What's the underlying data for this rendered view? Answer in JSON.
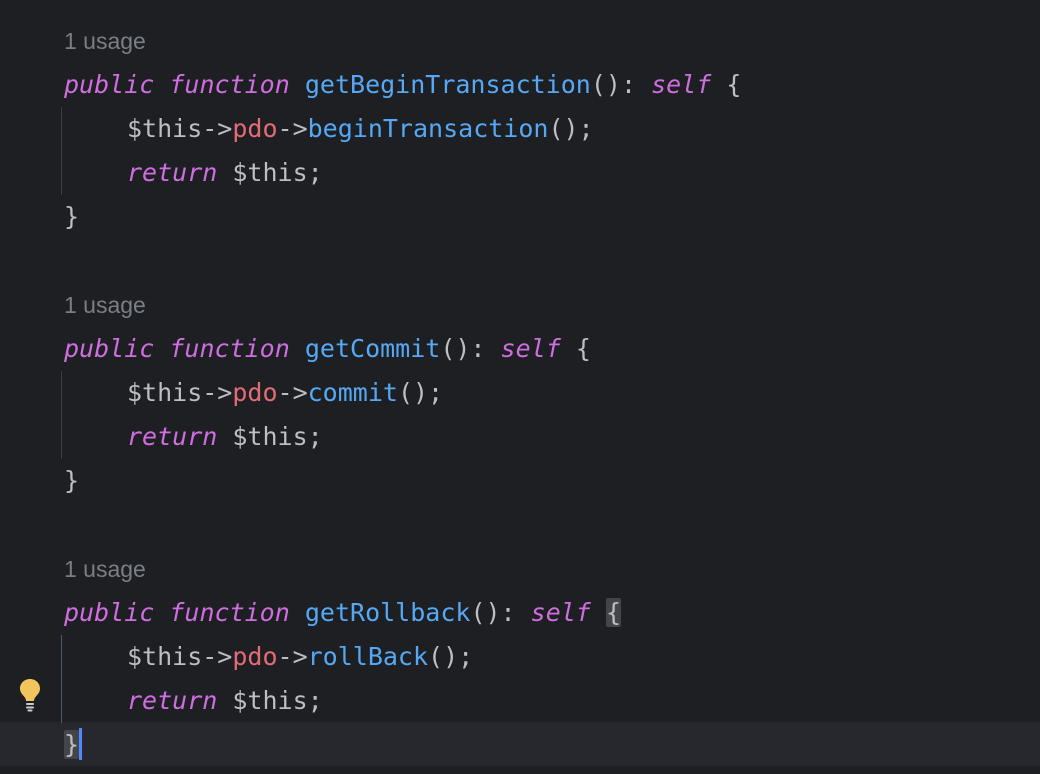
{
  "blocks": [
    {
      "usage": "1 usage",
      "kw_public": "public",
      "kw_function": "function",
      "fn_name": "getBeginTransaction",
      "sig_rest": "(): ",
      "kw_self": "self",
      "open_brace": " {",
      "this1": "$this->",
      "prop": "pdo",
      "arrow": "->",
      "method": "beginTransaction",
      "call_end": "();",
      "kw_return": "return",
      "ret_rest": " $this;",
      "close_brace": "}"
    },
    {
      "usage": "1 usage",
      "kw_public": "public",
      "kw_function": "function",
      "fn_name": "getCommit",
      "sig_rest": "(): ",
      "kw_self": "self",
      "open_brace": " {",
      "this1": "$this->",
      "prop": "pdo",
      "arrow": "->",
      "method": "commit",
      "call_end": "();",
      "kw_return": "return",
      "ret_rest": " $this;",
      "close_brace": "}"
    },
    {
      "usage": "1 usage",
      "kw_public": "public",
      "kw_function": "function",
      "fn_name": "getRollback",
      "sig_rest": "(): ",
      "kw_self": "self",
      "open_brace": "{",
      "this1": "$this->",
      "prop": "pdo",
      "arrow": "->",
      "method": "rollBack",
      "call_end": "();",
      "kw_return": "return",
      "ret_rest": " $this;",
      "close_brace": "}"
    }
  ],
  "gutter": {
    "intention_icon": "lightbulb-icon"
  },
  "colors": {
    "background": "#1e1f22",
    "keyword": "#cf6ee0",
    "function": "#56a8f5",
    "property": "#e06c75",
    "text": "#bcbec4",
    "usage_hint": "#7a7e85",
    "caret": "#4a8cff"
  }
}
